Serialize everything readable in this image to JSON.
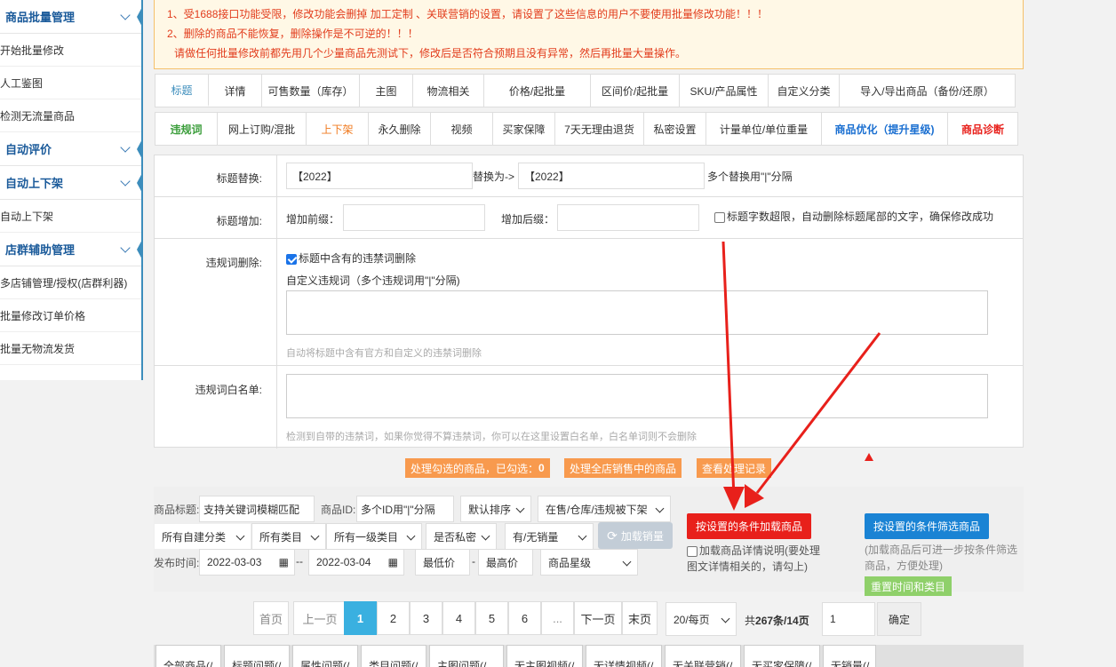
{
  "sidebar": {
    "groups": [
      {
        "title": "商品批量管理",
        "items": [
          "开始批量修改",
          "人工鉴图",
          "检测无流量商品"
        ]
      },
      {
        "title": "自动评价",
        "items": []
      },
      {
        "title": "自动上下架",
        "items": [
          "自动上下架"
        ]
      },
      {
        "title": "店群辅助管理",
        "items": [
          "多店铺管理/授权(店群利器)",
          "批量修改订单价格",
          "批量无物流发货"
        ]
      }
    ]
  },
  "notice": {
    "line1": "1、受1688接口功能受限，修改功能会删掉 加工定制 、关联营销的设置，请设置了这些信息的用户不要使用批量修改功能！！！",
    "line2": "2、删除的商品不能恢复，删除操作是不可逆的！！！",
    "line3": "请做任何批量修改前都先用几个少量商品先测试下，修改后是否符合预期且没有异常，然后再批量大量操作。"
  },
  "tabs1": [
    "标题",
    "详情",
    "可售数量（库存）",
    "主图",
    "物流相关",
    "价格/起批量",
    "区间价/起批量",
    "SKU/产品属性",
    "自定义分类",
    "导入/导出商品（备份/还原）"
  ],
  "tabs2": [
    "违规词",
    "网上订购/混批",
    "上下架",
    "永久删除",
    "视频",
    "买家保障",
    "7天无理由退货",
    "私密设置",
    "计量单位/单位重量",
    "商品优化（提升星级)",
    "商品诊断"
  ],
  "colors": {
    "green": "#3a9d3a",
    "orange": "#f07a1f",
    "blue": "#1a6fd1",
    "red": "#e8201b"
  },
  "form": {
    "replace_label": "标题替换:",
    "replace_from": "【2022】",
    "replace_to_label": "替换为->",
    "replace_to": "【2022】",
    "replace_hint": "多个替换用\"|\"分隔",
    "add_label": "标题增加:",
    "prefix_label": "增加前缀：",
    "suffix_label": "增加后缀：",
    "overlimit_text": "标题字数超限，自动删除标题尾部的文字，确保修改成功",
    "ban_label": "违规词删除:",
    "ban_check_text": "标题中含有的违禁词删除",
    "custom_ban_label": "自定义违规词（多个违规词用\"|\"分隔)",
    "ban_hint": "自动将标题中含有官方和自定义的违禁词删除",
    "whitelist_label": "违规词白名单:",
    "whitelist_hint": "检测到自带的违禁词，如果你觉得不算违禁词，你可以在这里设置白名单，白名单词则不会删除"
  },
  "actions": {
    "process_selected": "处理勾选的商品，已勾选：",
    "selected_count": "0",
    "process_all": "处理全店销售中的商品",
    "view_records": "查看处理记录"
  },
  "filter": {
    "title_label": "商品标题:",
    "title_placeholder": "支持关键词模糊匹配",
    "id_label": "商品ID:",
    "id_placeholder": "多个ID用\"|\"分隔",
    "sort": "默认排序",
    "status": "在售/仓库/违规被下架",
    "own_category": "所有自建分类",
    "all_category": "所有类目",
    "first_category": "所有一级类目",
    "private": "是否私密",
    "sales": "有/无销量",
    "load_sales": "加载销量",
    "time_label": "发布时间:",
    "date_from": "2022-03-03",
    "date_sep": "--",
    "date_to": "2022-03-04",
    "min_price": "最低价",
    "price_sep": "-",
    "max_price": "最高价",
    "star": "商品星级",
    "load_btn": "按设置的条件加载商品",
    "load_detail_text": "加载商品详情说明(要处理图文详情相关的，请勾上)",
    "filter_btn": "按设置的条件筛选商品",
    "filter_hint": "(加载商品后可进一步按条件筛选商品，方便处理)",
    "reset_btn": "重置时间和类目"
  },
  "pager": {
    "first": "首页",
    "prev": "上一页",
    "pages": [
      "1",
      "2",
      "3",
      "4",
      "5",
      "6",
      "..."
    ],
    "next": "下一页",
    "last": "末页",
    "per_page": "20/每页",
    "total_prefix": "共",
    "total": "267条/14页",
    "goto_value": "1",
    "confirm": "确定"
  },
  "bottom_tabs": [
    "全部商品(/",
    "标题问题(/",
    "属性问题(/",
    "类目问题(/",
    "主图问题(/",
    "无主图视频(/",
    "无详情视频(/",
    "无关联营销(/",
    "无买家保障(/",
    "无销量(/"
  ]
}
